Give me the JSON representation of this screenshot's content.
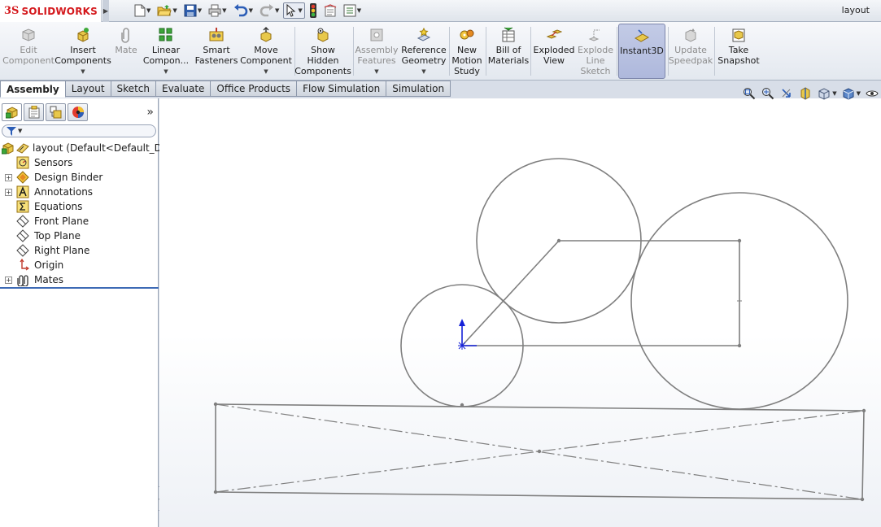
{
  "app": {
    "brand_mark": "3S",
    "brand_name": "SOLIDWORKS",
    "document_title": "layout"
  },
  "quick_access": {
    "items": [
      {
        "name": "new-document",
        "icon": "new-page-icon",
        "has_dropdown": true
      },
      {
        "name": "open-document",
        "icon": "open-folder-icon",
        "has_dropdown": true
      },
      {
        "name": "save-document",
        "icon": "floppy-disk-icon",
        "has_dropdown": true
      },
      {
        "name": "print",
        "icon": "printer-icon",
        "has_dropdown": true
      },
      {
        "name": "undo",
        "icon": "undo-arrow-icon",
        "has_dropdown": true
      },
      {
        "name": "redo",
        "icon": "redo-arrow-icon",
        "has_dropdown": true
      },
      {
        "name": "select",
        "icon": "cursor-arrow-icon",
        "has_dropdown": true
      },
      {
        "name": "rebuild",
        "icon": "traffic-light-icon",
        "has_dropdown": false
      },
      {
        "name": "file-properties",
        "icon": "file-properties-icon",
        "has_dropdown": false
      },
      {
        "name": "options",
        "icon": "options-list-icon",
        "has_dropdown": true
      }
    ]
  },
  "command_manager": {
    "edit_component": {
      "line1": "Edit",
      "line2": "Component"
    },
    "insert_components": {
      "line1": "Insert",
      "line2": "Components"
    },
    "mate": {
      "line1": "Mate"
    },
    "linear_component": {
      "line1": "Linear",
      "line2": "Compon..."
    },
    "smart_fasteners": {
      "line1": "Smart",
      "line2": "Fasteners"
    },
    "move_component": {
      "line1": "Move",
      "line2": "Component"
    },
    "show_hidden": {
      "line1": "Show",
      "line2": "Hidden",
      "line3": "Components"
    },
    "assembly_features": {
      "line1": "Assembly",
      "line2": "Features"
    },
    "reference_geometry": {
      "line1": "Reference",
      "line2": "Geometry"
    },
    "new_motion_study": {
      "line1": "New",
      "line2": "Motion",
      "line3": "Study"
    },
    "bill_of_materials": {
      "line1": "Bill of",
      "line2": "Materials"
    },
    "exploded_view": {
      "line1": "Exploded",
      "line2": "View"
    },
    "explode_line_sketch": {
      "line1": "Explode",
      "line2": "Line",
      "line3": "Sketch"
    },
    "instant3d": {
      "line1": "Instant3D"
    },
    "update_speedpak": {
      "line1": "Update",
      "line2": "Speedpak"
    },
    "take_snapshot": {
      "line1": "Take",
      "line2": "Snapshot"
    }
  },
  "tabs": [
    {
      "label": "Assembly",
      "active": true
    },
    {
      "label": "Layout",
      "active": false
    },
    {
      "label": "Sketch",
      "active": false
    },
    {
      "label": "Evaluate",
      "active": false
    },
    {
      "label": "Office Products",
      "active": false
    },
    {
      "label": "Flow Simulation",
      "active": false
    },
    {
      "label": "Simulation",
      "active": false
    }
  ],
  "feature_manager": {
    "panel_tabs": [
      "featuremanager-tree-icon",
      "property-manager-icon",
      "configuration-manager-icon",
      "display-manager-icon"
    ],
    "more_glyph": "»",
    "root_label": "layout  (Default<Default_Disp",
    "items": [
      {
        "label": "Sensors",
        "icon": "sensor-icon",
        "expandable": false
      },
      {
        "label": "Design Binder",
        "icon": "design-binder-icon",
        "expandable": true
      },
      {
        "label": "Annotations",
        "icon": "annotations-icon",
        "expandable": true
      },
      {
        "label": "Equations",
        "icon": "equations-icon",
        "expandable": false
      },
      {
        "label": "Front Plane",
        "icon": "plane-icon",
        "expandable": false
      },
      {
        "label": "Top Plane",
        "icon": "plane-icon",
        "expandable": false
      },
      {
        "label": "Right Plane",
        "icon": "plane-icon",
        "expandable": false
      },
      {
        "label": "Origin",
        "icon": "origin-icon",
        "expandable": false
      },
      {
        "label": "Mates",
        "icon": "mates-icon",
        "expandable": true
      }
    ]
  },
  "heads_up_toolbar": {
    "items": [
      "zoom-to-fit-icon",
      "zoom-to-area-icon",
      "previous-view-icon",
      "section-view-icon",
      "view-orientation-icon",
      "display-style-icon",
      "hide-show-items-icon"
    ]
  },
  "colors": {
    "brand_red": "#d4181c",
    "sketch_line": "#7f7f7f",
    "origin_blue": "#1420d8",
    "active_button": "#b4bde0"
  }
}
